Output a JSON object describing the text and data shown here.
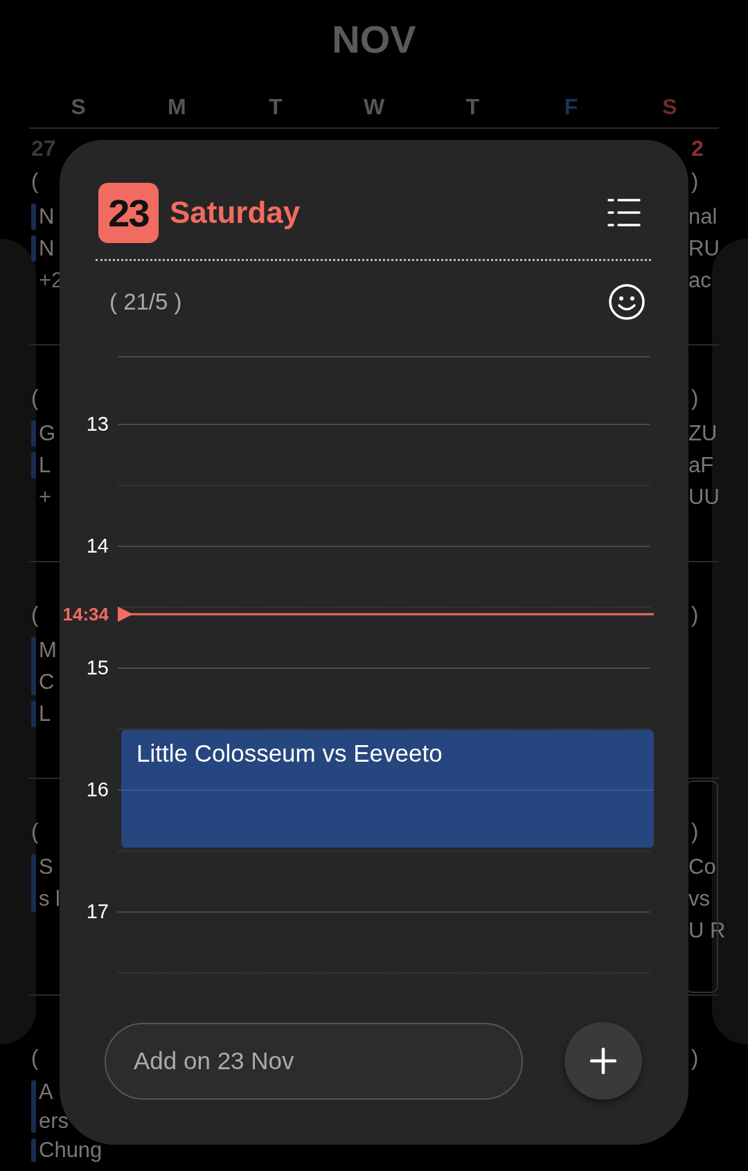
{
  "month": "NOV",
  "weekdays": [
    {
      "label": "S",
      "color": "#555555"
    },
    {
      "label": "M",
      "color": "#555555"
    },
    {
      "label": "T",
      "color": "#555555"
    },
    {
      "label": "W",
      "color": "#555555"
    },
    {
      "label": "T",
      "color": "#555555"
    },
    {
      "label": "F",
      "color": "#1f3358"
    },
    {
      "label": "S",
      "color": "#6a2b2b"
    }
  ],
  "weeks": [
    {
      "left": {
        "date": {
          "text": "27",
          "color": "#3a3a3a"
        },
        "paren": "(",
        "items": [
          {
            "kind": "event",
            "lines": [
              "N"
            ]
          },
          {
            "kind": "event",
            "lines": [
              "N"
            ]
          },
          {
            "kind": "more",
            "lines": [
              "+2"
            ]
          }
        ]
      },
      "right": {
        "date": {
          "text": "2",
          "color": "#8a2f2f"
        },
        "paren": ")",
        "selected": false,
        "items": [
          {
            "lines": [
              "nal"
            ]
          },
          {
            "lines": [
              "RU"
            ]
          },
          {
            "lines": [
              "ac"
            ]
          }
        ]
      }
    },
    {
      "left": {
        "paren": "(",
        "items": [
          {
            "kind": "event",
            "lines": [
              "G"
            ]
          },
          {
            "kind": "event",
            "lines": [
              "L"
            ]
          },
          {
            "kind": "more",
            "lines": [
              "+"
            ]
          }
        ]
      },
      "right": {
        "paren": ")",
        "selected": false,
        "items": [
          {
            "lines": [
              "ZU"
            ]
          },
          {
            "lines": [
              "aF"
            ]
          },
          {
            "lines": [
              "UU"
            ]
          }
        ]
      }
    },
    {
      "left": {
        "paren": "(",
        "items": [
          {
            "kind": "event",
            "lines": [
              "M",
              "C"
            ]
          },
          {
            "kind": "event",
            "lines": [
              "L"
            ]
          }
        ]
      },
      "right": {
        "paren": ")",
        "selected": false
      }
    },
    {
      "left": {
        "paren": "(",
        "items": [
          {
            "kind": "event",
            "lines": [
              "S",
              "s l"
            ]
          }
        ]
      },
      "right": {
        "paren": ")",
        "selected": true,
        "items": [
          {
            "lines": [
              "Co"
            ]
          },
          {
            "lines": [
              "vs"
            ]
          },
          {
            "lines": [
              "U R"
            ]
          }
        ]
      }
    },
    {
      "left": {
        "paren": "(",
        "items": [
          {
            "kind": "event",
            "lines": [
              "A",
              "ers"
            ]
          },
          {
            "kind": "event",
            "lines": [
              "Chung"
            ]
          }
        ]
      },
      "right": {
        "paren": ")",
        "selected": false
      }
    }
  ],
  "dialog": {
    "badge": "23",
    "day": "Saturday",
    "lunar": "( 21/5 )",
    "hours": [
      "13",
      "14",
      "15",
      "16",
      "17"
    ],
    "now": "14:34",
    "events": [
      {
        "title": "Little Colosseum vs Eeveeto"
      }
    ],
    "add_field": {
      "placeholder": "Add on 23 Nov"
    }
  }
}
